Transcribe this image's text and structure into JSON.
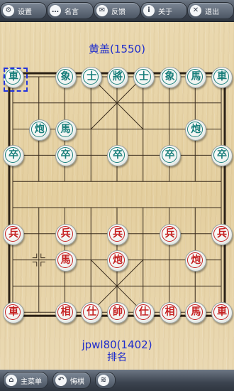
{
  "toolbar": [
    {
      "label": "设置",
      "icon": "gear-icon",
      "glyph": "⚙"
    },
    {
      "label": "名言",
      "icon": "speech-bubble-icon",
      "glyph": "…"
    },
    {
      "label": "反馈",
      "icon": "mail-icon",
      "glyph": "✉"
    },
    {
      "label": "关于",
      "icon": "info-icon",
      "glyph": "i"
    },
    {
      "label": "退出",
      "icon": "close-icon",
      "glyph": "✕"
    }
  ],
  "opponent": "黄盖(1550)",
  "player": "jpwl80(1402)",
  "rank_label": "排名",
  "bottom_bar": [
    {
      "label": "主菜单",
      "icon": "home-icon",
      "glyph": "⌂"
    },
    {
      "label": "悔棋",
      "icon": "undo-icon",
      "glyph": "↶"
    },
    {
      "label": "",
      "icon": "wifi-icon",
      "glyph": "≋"
    }
  ],
  "board": {
    "files": 9,
    "ranks": 10,
    "colors": {
      "blue": "#167d79",
      "red": "#c52020",
      "selection": "#2233dd"
    }
  },
  "selection": {
    "file": 0,
    "rank": 0
  },
  "pieces": [
    {
      "side": "blue",
      "char": "車",
      "file": 0,
      "rank": 0
    },
    {
      "side": "blue",
      "char": "象",
      "file": 2,
      "rank": 0
    },
    {
      "side": "blue",
      "char": "士",
      "file": 3,
      "rank": 0
    },
    {
      "side": "blue",
      "char": "將",
      "file": 4,
      "rank": 0
    },
    {
      "side": "blue",
      "char": "士",
      "file": 5,
      "rank": 0
    },
    {
      "side": "blue",
      "char": "象",
      "file": 6,
      "rank": 0
    },
    {
      "side": "blue",
      "char": "馬",
      "file": 7,
      "rank": 0
    },
    {
      "side": "blue",
      "char": "車",
      "file": 8,
      "rank": 0
    },
    {
      "side": "blue",
      "char": "炮",
      "file": 1,
      "rank": 2
    },
    {
      "side": "blue",
      "char": "馬",
      "file": 2,
      "rank": 2
    },
    {
      "side": "blue",
      "char": "炮",
      "file": 7,
      "rank": 2
    },
    {
      "side": "blue",
      "char": "卒",
      "file": 0,
      "rank": 3
    },
    {
      "side": "blue",
      "char": "卒",
      "file": 2,
      "rank": 3
    },
    {
      "side": "blue",
      "char": "卒",
      "file": 4,
      "rank": 3
    },
    {
      "side": "blue",
      "char": "卒",
      "file": 6,
      "rank": 3
    },
    {
      "side": "blue",
      "char": "卒",
      "file": 8,
      "rank": 3
    },
    {
      "side": "red",
      "char": "兵",
      "file": 0,
      "rank": 6
    },
    {
      "side": "red",
      "char": "兵",
      "file": 2,
      "rank": 6
    },
    {
      "side": "red",
      "char": "兵",
      "file": 4,
      "rank": 6
    },
    {
      "side": "red",
      "char": "兵",
      "file": 6,
      "rank": 6
    },
    {
      "side": "red",
      "char": "兵",
      "file": 8,
      "rank": 6
    },
    {
      "side": "red",
      "char": "馬",
      "file": 2,
      "rank": 7
    },
    {
      "side": "red",
      "char": "炮",
      "file": 4,
      "rank": 7
    },
    {
      "side": "red",
      "char": "炮",
      "file": 7,
      "rank": 7
    },
    {
      "side": "red",
      "char": "車",
      "file": 0,
      "rank": 9
    },
    {
      "side": "red",
      "char": "相",
      "file": 2,
      "rank": 9
    },
    {
      "side": "red",
      "char": "仕",
      "file": 3,
      "rank": 9
    },
    {
      "side": "red",
      "char": "帥",
      "file": 4,
      "rank": 9
    },
    {
      "side": "red",
      "char": "仕",
      "file": 5,
      "rank": 9
    },
    {
      "side": "red",
      "char": "相",
      "file": 6,
      "rank": 9
    },
    {
      "side": "red",
      "char": "馬",
      "file": 7,
      "rank": 9
    },
    {
      "side": "red",
      "char": "車",
      "file": 8,
      "rank": 9
    }
  ]
}
